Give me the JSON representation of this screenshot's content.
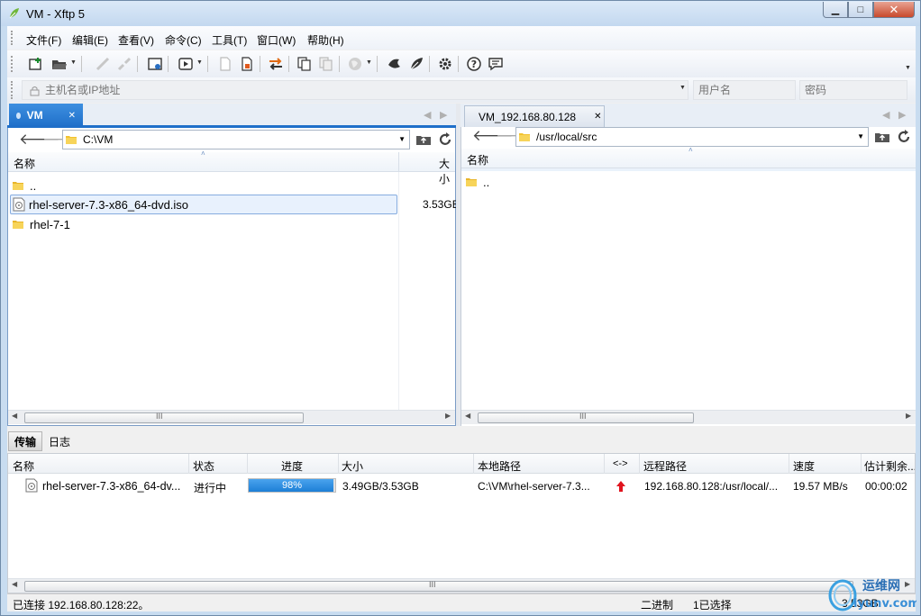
{
  "window": {
    "title": "VM - Xftp 5",
    "min": "▁",
    "max": "□",
    "close": "✕"
  },
  "menu": [
    {
      "label": "文件(F)"
    },
    {
      "label": "编辑(E)"
    },
    {
      "label": "查看(V)"
    },
    {
      "label": "命令(C)"
    },
    {
      "label": "工具(T)"
    },
    {
      "label": "窗口(W)"
    },
    {
      "label": "帮助(H)"
    }
  ],
  "address": {
    "host_placeholder": "主机名或IP地址",
    "user_placeholder": "用户名",
    "password_placeholder": "密码"
  },
  "local": {
    "tab_label": "VM",
    "path": "C:\\VM",
    "col_name": "名称",
    "col_size": "大小",
    "files": [
      {
        "name": "..",
        "size": "",
        "type": "folder"
      },
      {
        "name": "rhel-server-7.3-x86_64-dvd.iso",
        "size": "3.53GB",
        "type": "file"
      },
      {
        "name": "rhel-7-1",
        "size": "",
        "type": "folder"
      }
    ],
    "scroll_grip": "III"
  },
  "remote": {
    "tab_label": "VM_192.168.80.128",
    "path": "/usr/local/src",
    "col_name": "名称",
    "files": [
      {
        "name": "..",
        "type": "folder"
      }
    ],
    "scroll_grip": "III",
    "status_color": "#22b14c"
  },
  "bottom_tabs": {
    "transfer": "传输",
    "log": "日志"
  },
  "transfer": {
    "columns": {
      "name": "名称",
      "status": "状态",
      "progress": "进度",
      "size": "大小",
      "local_path": "本地路径",
      "direction": "<->",
      "remote_path": "远程路径",
      "speed": "速度",
      "eta": "估计剩余..."
    },
    "rows": [
      {
        "name": "rhel-server-7.3-x86_64-dv...",
        "status": "进行中",
        "progress_text": "98%",
        "progress_fraction": 0.98,
        "size": "3.49GB/3.53GB",
        "local_path": "C:\\VM\\rhel-server-7.3...",
        "remote_path": "192.168.80.128:/usr/local/...",
        "speed": "19.57 MB/s",
        "eta": "00:00:02"
      }
    ],
    "scroll_grip": "III"
  },
  "status": {
    "connection": "已连接 192.168.80.128:22。",
    "mode": "二进制",
    "selected": "1已选择",
    "size": "3.53GB"
  },
  "watermark": {
    "line1": "运维网",
    "line2": "iyunv.com"
  },
  "colors": {
    "accent": "#1f6fc9",
    "folder": "#f2c230",
    "upload_arrow": "#e0141e"
  }
}
